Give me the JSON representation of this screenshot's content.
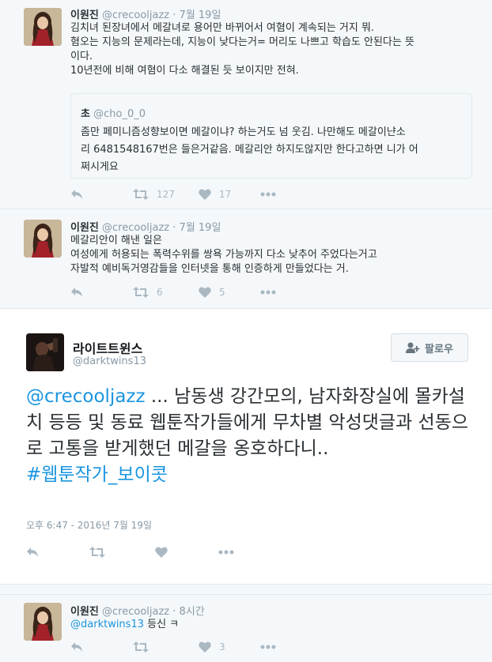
{
  "tweets": [
    {
      "name": "이원진",
      "handle": "@crecooljazz",
      "time": "· 7월 19일",
      "lines": [
        "김치녀 된장녀에서 메갈녀로 용어만 바뀌어서 여혐이 계속되는 거지 뭐.",
        "혐오는 지능의 문제라는데, 지능이 낮다는거= 머리도 나쁘고 학습도 안된다는 뜻",
        "이다.",
        "10년전에 비해 여혐이 다소 해결된 듯 보이지만 전혀."
      ],
      "quote": {
        "name": "초",
        "handle": "@cho_0_0",
        "lines": [
          "좀만 페미니즘성향보이면 메갈이냐? 하는거도 넘 웃김. 나만해도 메갈이냔소",
          "리 6481548167번은 들은거같음. 메갈리안 하지도않지만 한다고하면 니가 어",
          "쩌시게요"
        ]
      },
      "retweets": "127",
      "likes": "17"
    },
    {
      "name": "이원진",
      "handle": "@crecooljazz",
      "time": "· 7월 19일",
      "lines": [
        "메갈리안이 해낸 일은",
        "여성에게 허용되는 폭력수위를 쌍욕 가능까지 다소 낮추어 주었다는거고",
        "자발적 예비독거영감들을 인터넷을 통해 인증하게 만들었다는 거."
      ],
      "retweets": "6",
      "likes": "5"
    }
  ],
  "focus": {
    "name": "라이트트윈스",
    "handle": "@darktwins13",
    "follow_label": "팔로우",
    "mention": "@crecooljazz",
    "text": " ... 남동생 강간모의, 남자화장실에 몰카설치 등등 및 동료 웹툰작가들에게 무차별 악성댓글과 선동으로 고통을 받게했던 메갈을 옹호하다니..",
    "hashtag": "#웹툰작가_보이콧",
    "date": "오후 6:47 - 2016년 7월 19일"
  },
  "reply": {
    "name": "이원진",
    "handle": "@crecooljazz",
    "time": "· 8시간",
    "mention": "@darktwins13",
    "text": " 등신 ㅋ",
    "likes": "3"
  },
  "icons": {
    "reply": "reply-icon",
    "retweet": "retweet-icon",
    "like": "heart-icon",
    "more": "more-icon",
    "follow": "add-user-icon"
  }
}
